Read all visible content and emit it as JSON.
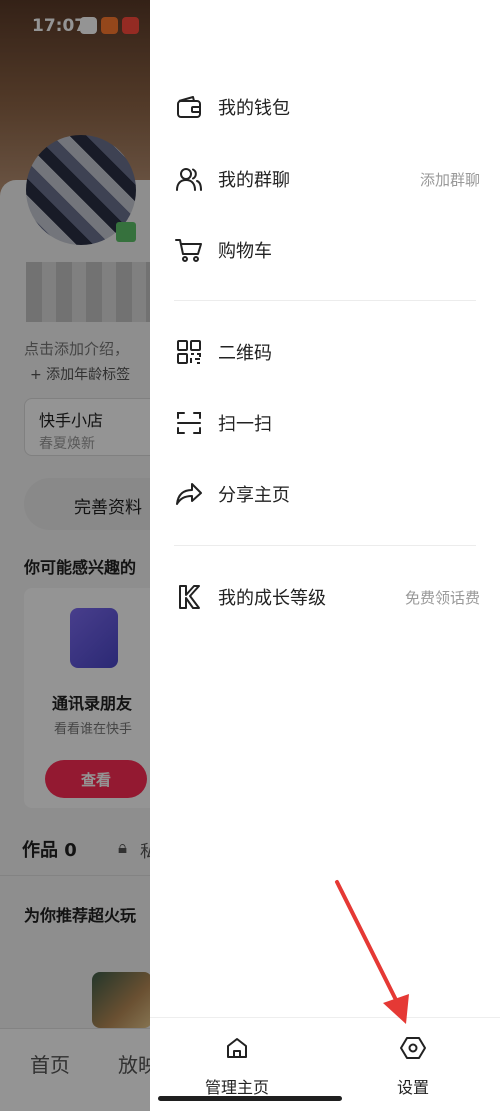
{
  "status_bar": {
    "time": "17:07"
  },
  "background_profile": {
    "intro_hint": "点击添加介绍，",
    "age_tag": "+ 添加年龄标签",
    "shop": {
      "title": "快手小店",
      "subtitle": "春夏焕新"
    },
    "complete_profile": "完善资料",
    "interest_heading": "你可能感兴趣的",
    "contacts_card": {
      "title": "通讯录朋友",
      "subtitle": "看看谁在快手",
      "button": "查看"
    },
    "works_tab": "作品 0",
    "private_tab": "私",
    "recommend_heading": "为你推荐超火玩",
    "bottom_tabs": [
      "首页",
      "放映"
    ]
  },
  "drawer": {
    "section1": [
      {
        "icon": "wallet-icon",
        "label": "我的钱包",
        "side": ""
      },
      {
        "icon": "group-chat-icon",
        "label": "我的群聊",
        "side": "添加群聊"
      },
      {
        "icon": "cart-icon",
        "label": "购物车",
        "side": ""
      }
    ],
    "section2": [
      {
        "icon": "qr-code-icon",
        "label": "二维码",
        "side": ""
      },
      {
        "icon": "scan-icon",
        "label": "扫一扫",
        "side": ""
      },
      {
        "icon": "share-icon",
        "label": "分享主页",
        "side": ""
      }
    ],
    "section3": [
      {
        "icon": "growth-level-icon",
        "label": "我的成长等级",
        "side": "免费领话费"
      }
    ],
    "bottom": {
      "manage_home": "管理主页",
      "settings": "设置"
    }
  },
  "annotation": {
    "arrow_color": "#e53935"
  }
}
